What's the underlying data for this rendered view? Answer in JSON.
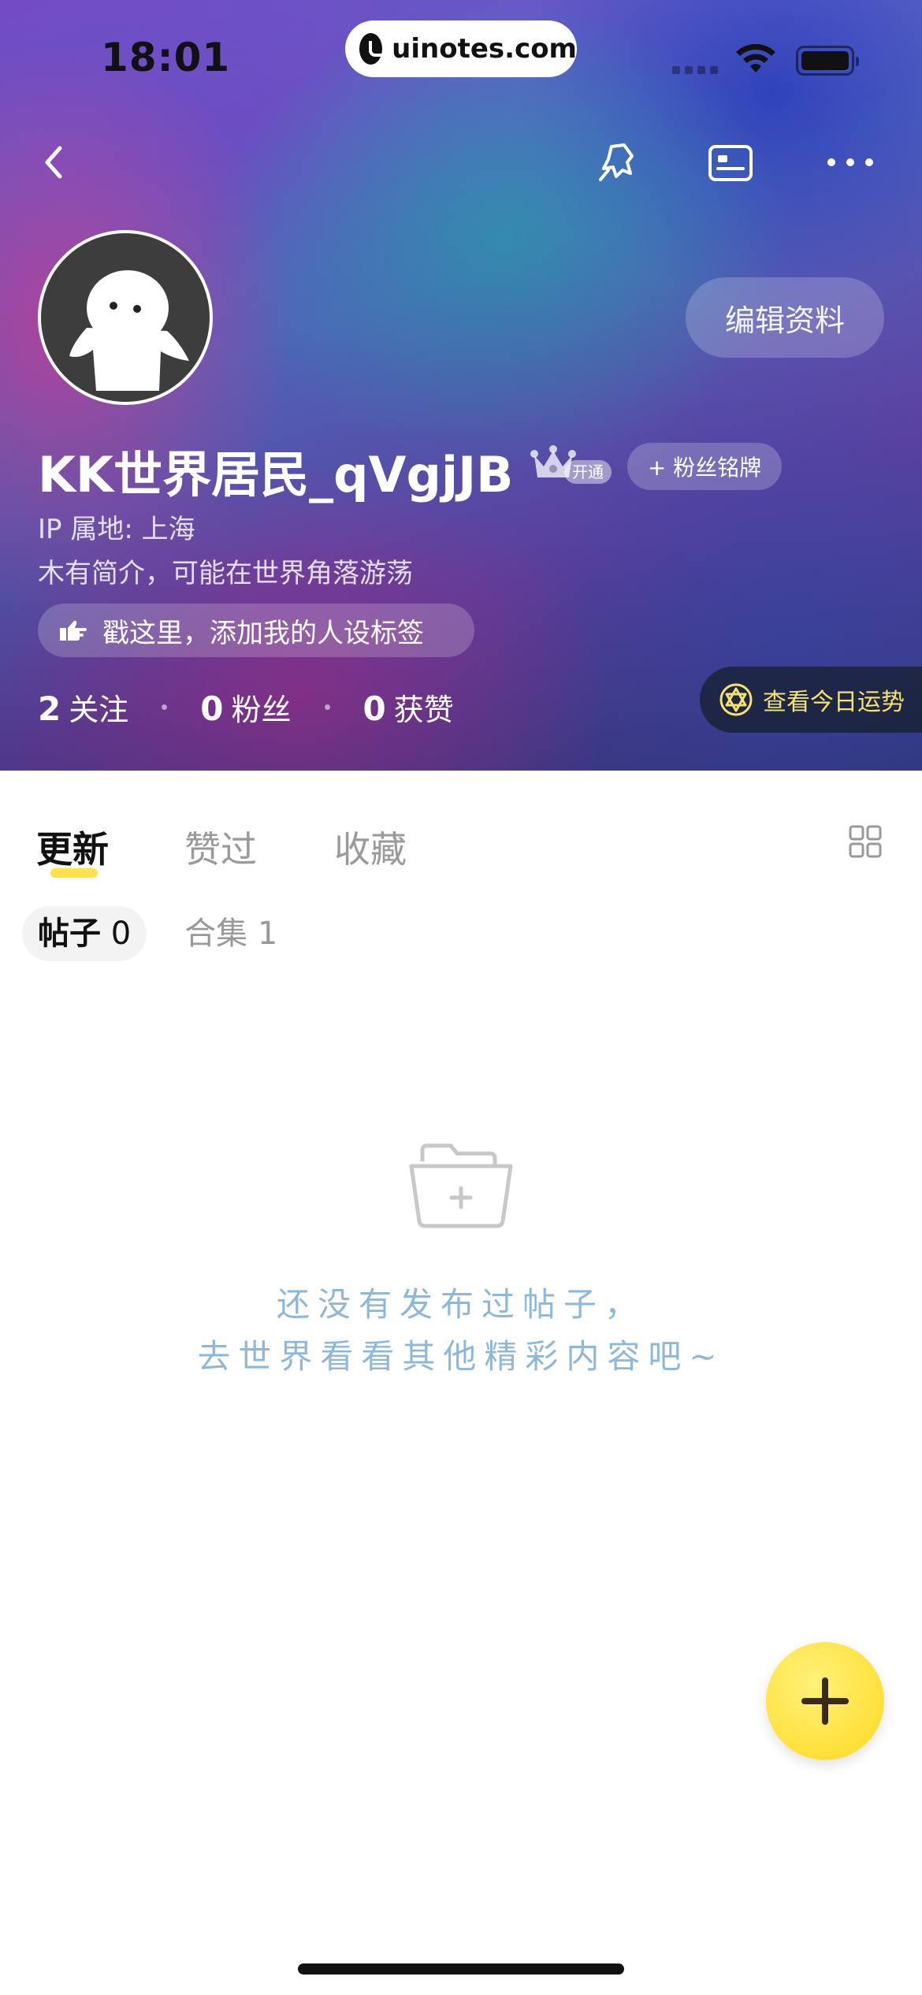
{
  "status_bar": {
    "time": "18:01",
    "url": "uinotes.com"
  },
  "nav": {
    "back_icon": "chevron-left-icon",
    "pin_icon": "pin-icon",
    "card_icon": "id-card-icon",
    "more_icon": "more-dots-icon"
  },
  "profile": {
    "username": "KK世界居民_qVgjJB",
    "vip_tag": "开通",
    "fan_badge_label": "+ 粉丝铭牌",
    "edit_label": "编辑资料",
    "ip_location": "IP 属地: 上海",
    "bio": "木有简介，可能在世界角落游荡",
    "tag_prompt": "戳这里，添加我的人设标签"
  },
  "stats": [
    {
      "num": "2",
      "label": "关注"
    },
    {
      "num": "0",
      "label": "粉丝"
    },
    {
      "num": "0",
      "label": "获赞"
    }
  ],
  "fortune": {
    "label": "查看今日运势",
    "color": "#f7e36b"
  },
  "tabs": [
    {
      "label": "更新",
      "active": true
    },
    {
      "label": "赞过",
      "active": false
    },
    {
      "label": "收藏",
      "active": false
    }
  ],
  "subtabs": [
    {
      "name": "帖子",
      "count": "0",
      "active": true
    },
    {
      "name": "合集",
      "count": "1",
      "active": false
    }
  ],
  "empty_state": {
    "line1": "还没有发布过帖子，",
    "line2": "去世界看看其他精彩内容吧~",
    "icon": "folder-plus-icon"
  },
  "colors": {
    "accent": "#ffe14a",
    "empty_text": "#8fb8d8"
  }
}
